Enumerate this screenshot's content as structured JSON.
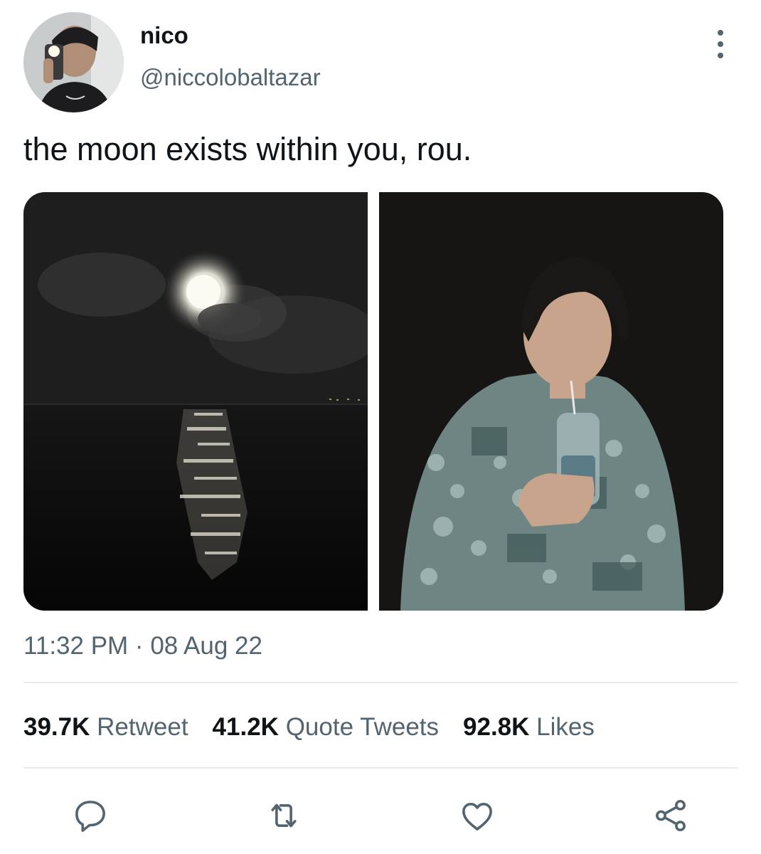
{
  "user": {
    "display_name": "nico",
    "handle": "@niccolobaltazar",
    "avatar_icon": "profile-photo"
  },
  "tweet": {
    "text": "the moon exists within you, rou.",
    "timestamp": "11:32 PM · 08 Aug 22"
  },
  "media": [
    {
      "icon": "night-moon-over-sea-photo"
    },
    {
      "icon": "person-holding-drink-photo"
    }
  ],
  "stats": {
    "retweets": {
      "count": "39.7K",
      "label": "Retweet"
    },
    "quotes": {
      "count": "41.2K",
      "label": "Quote Tweets"
    },
    "likes": {
      "count": "92.8K",
      "label": "Likes"
    }
  },
  "actions": [
    {
      "icon": "reply-icon"
    },
    {
      "icon": "retweet-icon"
    },
    {
      "icon": "like-icon"
    },
    {
      "icon": "share-icon"
    }
  ],
  "colors": {
    "text_primary": "#0f1419",
    "text_secondary": "#536471",
    "divider": "#e7eaec"
  }
}
